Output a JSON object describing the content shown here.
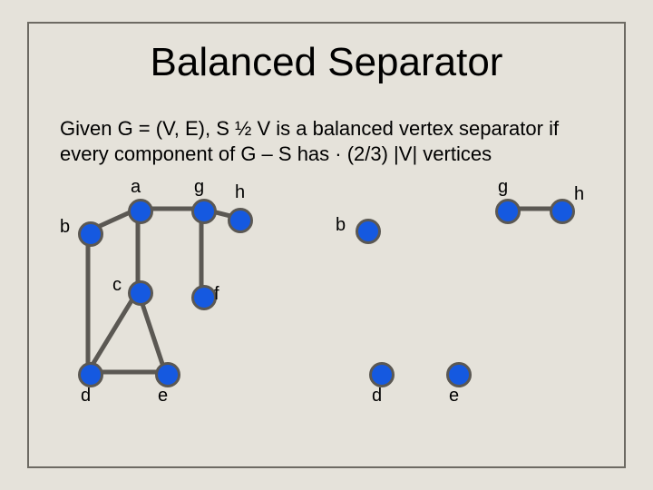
{
  "title": "Balanced Separator",
  "paragraph": "Given G = (V, E),   S ½ V is a balanced vertex separator if every component of G – S  has · (2/3) |V| vertices",
  "left_graph": {
    "labels": {
      "a": "a",
      "b": "b",
      "c": "c",
      "d": "d",
      "e": "e",
      "f": "f",
      "g": "g",
      "h": "h"
    }
  },
  "right_graph": {
    "labels": {
      "b": "b",
      "d": "d",
      "e": "e",
      "g": "g",
      "h": "h"
    }
  }
}
